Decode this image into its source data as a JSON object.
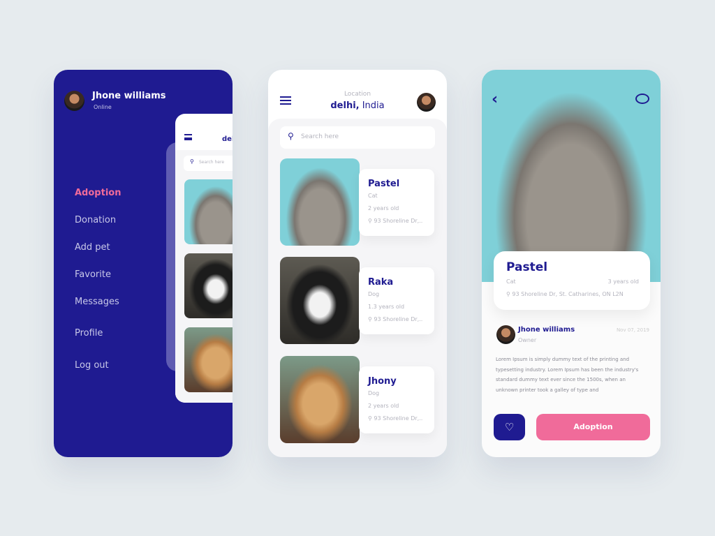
{
  "colors": {
    "primary": "#1f1b91",
    "accent": "#f06b9a",
    "background": "#e6ebee"
  },
  "menu_screen": {
    "user_name": "Jhone williams",
    "status": "Online",
    "items": [
      {
        "label": "Adoption",
        "active": true
      },
      {
        "label": "Donation"
      },
      {
        "label": "Add pet"
      },
      {
        "label": "Favorite"
      },
      {
        "label": "Messages"
      },
      {
        "label": "Profile"
      },
      {
        "label": "Log out"
      }
    ],
    "preview": {
      "location_bold": "del",
      "search_placeholder": "Search here"
    }
  },
  "list_screen": {
    "location_label": "Location",
    "city": "delhi,",
    "country": " India",
    "search_placeholder": "Search here",
    "pets": [
      {
        "name": "Pastel",
        "type": "Cat",
        "age": "2 years old",
        "address": "93 Shoreline Dr,.."
      },
      {
        "name": "Raka",
        "type": "Dog",
        "age": "1.3 years old",
        "address": "93 Shoreline Dr,.."
      },
      {
        "name": "Jhony",
        "type": "Dog",
        "age": "2 years old",
        "address": "93 Shoreline Dr,.."
      }
    ]
  },
  "detail_screen": {
    "name": "Pastel",
    "type": "Cat",
    "age": "3 years old",
    "address": "93 Shoreline Dr, St. Catharines, ON L2N",
    "owner_name": "Jhone williams",
    "owner_role": "Owner",
    "date": "Nov 07, 2019",
    "description": "Lorem Ipsum is simply dummy text of the printing and typesetting industry. Lorem Ipsum has been the industry's standard dummy text ever since the 1500s, when an unknown printer took a galley of type and",
    "adopt_label": "Adoption"
  }
}
